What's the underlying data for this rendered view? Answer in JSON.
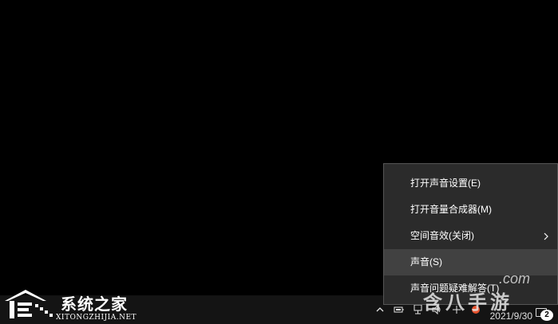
{
  "context_menu": {
    "items": [
      {
        "label": "打开声音设置(E)",
        "has_submenu": false,
        "highlighted": false
      },
      {
        "label": "打开音量合成器(M)",
        "has_submenu": false,
        "highlighted": false
      },
      {
        "label": "空间音效(关闭)",
        "has_submenu": true,
        "highlighted": false
      },
      {
        "label": "声音(S)",
        "has_submenu": false,
        "highlighted": true
      },
      {
        "label": "声音问题疑难解答(T)",
        "has_submenu": false,
        "highlighted": false
      }
    ]
  },
  "taskbar": {
    "clock_date": "2021/9/30",
    "notification_count": "2",
    "tray_icons": [
      "chevron-up-icon",
      "network-icon",
      "network-wired-icon",
      "volume-icon",
      "ime-icon",
      "app-icon"
    ]
  },
  "watermark_left": {
    "title": "系统之家",
    "url": "XITONGZHIJIA.NET"
  },
  "watermark_right": {
    "com": ".com",
    "brand": "含八手游"
  },
  "colors": {
    "menu_bg": "#2b2b2b",
    "menu_hover": "#414141",
    "menu_border": "#555555",
    "taskbar_bg": "#141414",
    "text": "#ffffff"
  }
}
